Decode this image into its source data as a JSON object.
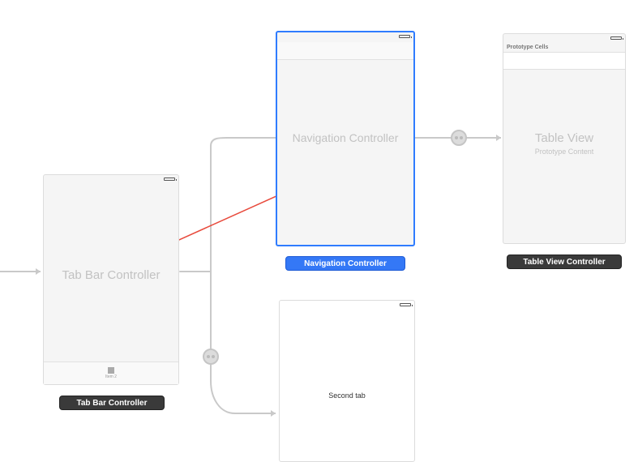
{
  "scenes": {
    "tabbar": {
      "title": "Tab Bar Controller",
      "tab_item_label": "Item 2",
      "label": "Tab Bar Controller"
    },
    "nav": {
      "title": "Navigation Controller",
      "label": "Navigation Controller"
    },
    "table": {
      "proto_header": "Prototype Cells",
      "title": "Table View",
      "subtitle": "Prototype Content",
      "label": "Table View Controller"
    },
    "second": {
      "title": "Second tab"
    }
  }
}
